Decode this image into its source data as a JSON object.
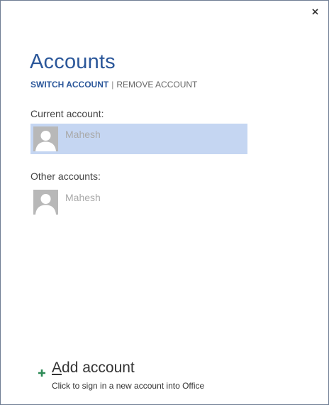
{
  "dialog": {
    "title": "Accounts",
    "close_icon": "close-icon"
  },
  "tabs": {
    "switch": "SWITCH ACCOUNT",
    "separator": "|",
    "remove": "REMOVE ACCOUNT"
  },
  "current": {
    "label": "Current account:",
    "account_name": "Mahesh",
    "avatar_icon": "person-icon",
    "selected_color": "#c5d6f2"
  },
  "other": {
    "label": "Other accounts:",
    "account_name": "Mahesh",
    "avatar_icon": "person-icon"
  },
  "add_account": {
    "icon": "plus-icon",
    "title_first": "A",
    "title_rest": "dd account",
    "subtitle": "Click to sign in a new account into Office",
    "accent_color": "#2e8b57"
  },
  "colors": {
    "title": "#2b579a",
    "border": "#6f7d93"
  }
}
